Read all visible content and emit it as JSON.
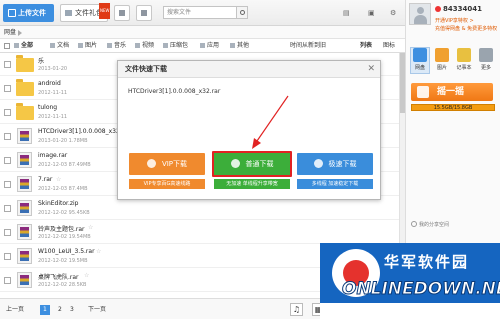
{
  "toolbar": {
    "upload": "上传文件",
    "gift": "文件礼包",
    "new_badge": "NEW",
    "search_placeholder": "搜索文件"
  },
  "breadcrumb": {
    "root": "网盘"
  },
  "filters": {
    "all": "全部",
    "items": [
      "文档",
      "图片",
      "音乐",
      "视频",
      "压缩包",
      "应用",
      "其他"
    ],
    "sort": "时间从新到旧",
    "view_list": "列表",
    "view_icons": "图标"
  },
  "files": [
    {
      "name": "乐",
      "meta": "2013-01-20",
      "type": "folder"
    },
    {
      "name": "android",
      "meta": "2012-11-11",
      "type": "folder"
    },
    {
      "name": "tulong",
      "meta": "2012-11-11",
      "type": "folder"
    },
    {
      "name": "HTCDriver3[1].0.0.008_x32.rar",
      "meta": "2013-01-20  1.78MB",
      "type": "rar"
    },
    {
      "name": "image.rar",
      "meta": "2012-12-03  87.49MB",
      "type": "rar"
    },
    {
      "name": "7.rar",
      "meta": "2012-12-03  87.4MB",
      "type": "rar"
    },
    {
      "name": "SkinEditor.zip",
      "meta": "2012-12-02  95.45KB",
      "type": "rar"
    },
    {
      "name": "铃声及主题包.rar",
      "meta": "2012-12-02  19.54MB",
      "type": "rar"
    },
    {
      "name": "W100_LeUI_3.5.rar",
      "meta": "2012-12-02  19.5MB",
      "type": "rar"
    },
    {
      "name": "桌牌飞虎队.rar",
      "meta": "2012-12-02  28.5KB",
      "type": "rar"
    }
  ],
  "pager": {
    "prev": "上一页",
    "p1": "1",
    "p2": "2",
    "p3": "3",
    "next": "下一页"
  },
  "user": {
    "id": "84334041",
    "vip_line1": "开通VIP享特权 >",
    "vip_line2": "充值得网盘 & 免费更多特权"
  },
  "apps": [
    {
      "label": "网盘",
      "color": "#3d8fe0"
    },
    {
      "label": "图片",
      "color": "#f0a030"
    },
    {
      "label": "记事本",
      "color": "#e8c040"
    },
    {
      "label": "更多",
      "color": "#9aa4ae"
    }
  ],
  "shake": "摇一摇",
  "storage": "15.5GB/15.8GB",
  "share": "我的分享空间",
  "dialog": {
    "title": "文件快速下载",
    "filename": "HTCDriver3[1].0.0.008_x32.rar",
    "vip_btn": "VIP下载",
    "vip_note": "VIP专享百G高速线路",
    "normal_btn": "普通下载",
    "normal_note": "无加速 单线程升享带宽",
    "fast_btn": "极速下载",
    "fast_note": "多线程 加速稳定下载"
  },
  "watermark": {
    "cn": "华军软件园",
    "en": "ONLINEDOWN.NET"
  },
  "colors": {
    "accent": "#3d8fe0",
    "vip": "#f08a2e",
    "normal": "#3cae3a",
    "fast": "#3a8ddb",
    "highlight": "#e12222"
  }
}
